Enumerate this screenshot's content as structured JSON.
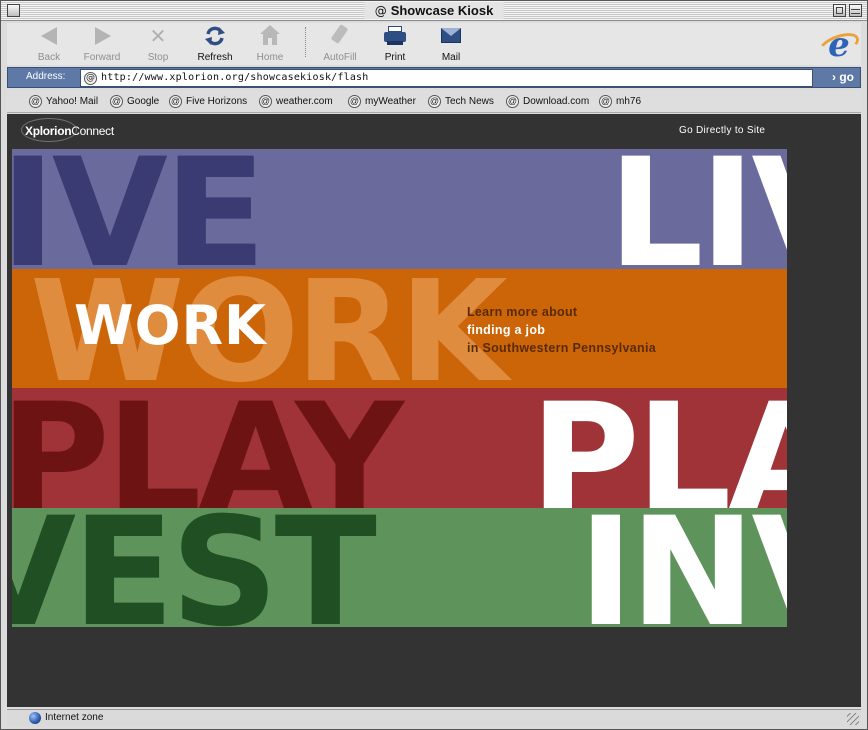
{
  "window": {
    "title": "Showcase Kiosk",
    "title_icon": "@"
  },
  "toolbar": {
    "back": "Back",
    "forward": "Forward",
    "stop": "Stop",
    "refresh": "Refresh",
    "home": "Home",
    "autofill": "AutoFill",
    "print": "Print",
    "mail": "Mail"
  },
  "address": {
    "label": "Address:",
    "url": "http://www.xplorion.org/showcasekiosk/flash",
    "go": "go"
  },
  "favorites": [
    "Yahoo! Mail",
    "Google",
    "Five Horizons",
    "weather.com",
    "myWeather",
    "Tech News",
    "Download.com",
    "mh76"
  ],
  "content": {
    "brand_bold": "Xplorion",
    "brand_rest": "Connect",
    "go_directly": "Go Directly to Site",
    "bands": {
      "live_left": "IVE",
      "live_right": "LIV",
      "work_bg": "WORK",
      "work_title": "WORK",
      "play_left": "PLAY",
      "play_right": "PLA",
      "invest_left": "VEST",
      "invest_right": "INV"
    },
    "work_text": {
      "line1": "Learn more about",
      "line2": "finding a job",
      "line3": "in Southwestern Pennsylvania"
    },
    "colors": {
      "live": "#6a6a9c",
      "work": "#cb6508",
      "play": "#9f3337",
      "invest": "#5e945b"
    }
  },
  "status": {
    "zone": "Internet zone"
  }
}
